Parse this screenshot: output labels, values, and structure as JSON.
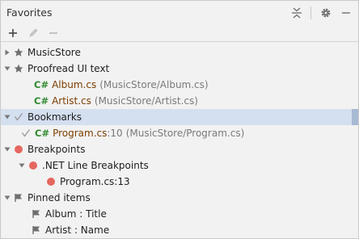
{
  "panel": {
    "title": "Favorites",
    "header_icons": [
      "collapse-all-icon",
      "gear-icon",
      "minimize-icon"
    ],
    "toolbar": [
      "add-icon",
      "edit-icon",
      "remove-icon"
    ]
  },
  "tree": {
    "musicstore": {
      "label": "MusicStore"
    },
    "proofread": {
      "label": "Proofread UI text",
      "album": {
        "lang": "C#",
        "file": "Album.cs",
        "path": "(MusicStore/Album.cs)"
      },
      "artist": {
        "lang": "C#",
        "file": "Artist.cs",
        "path": "(MusicStore/Artist.cs)"
      }
    },
    "bookmarks": {
      "label": "Bookmarks",
      "program": {
        "lang": "C#",
        "file": "Program.cs",
        "line": ":10",
        "path": "(MusicStore/Program.cs)"
      }
    },
    "breakpoints": {
      "label": "Breakpoints",
      "dotnet": {
        "label": ".NET Line Breakpoints"
      },
      "program": {
        "label": "Program.cs:13"
      }
    },
    "pinned": {
      "label": "Pinned items",
      "album": {
        "label": "Album : Title"
      },
      "artist": {
        "label": "Artist : Name"
      }
    }
  },
  "colors": {
    "selection": "#d4dff0",
    "csharp": "#2f8a2f",
    "breakpoint": "#e5675f",
    "star": "#6f6f6f"
  }
}
